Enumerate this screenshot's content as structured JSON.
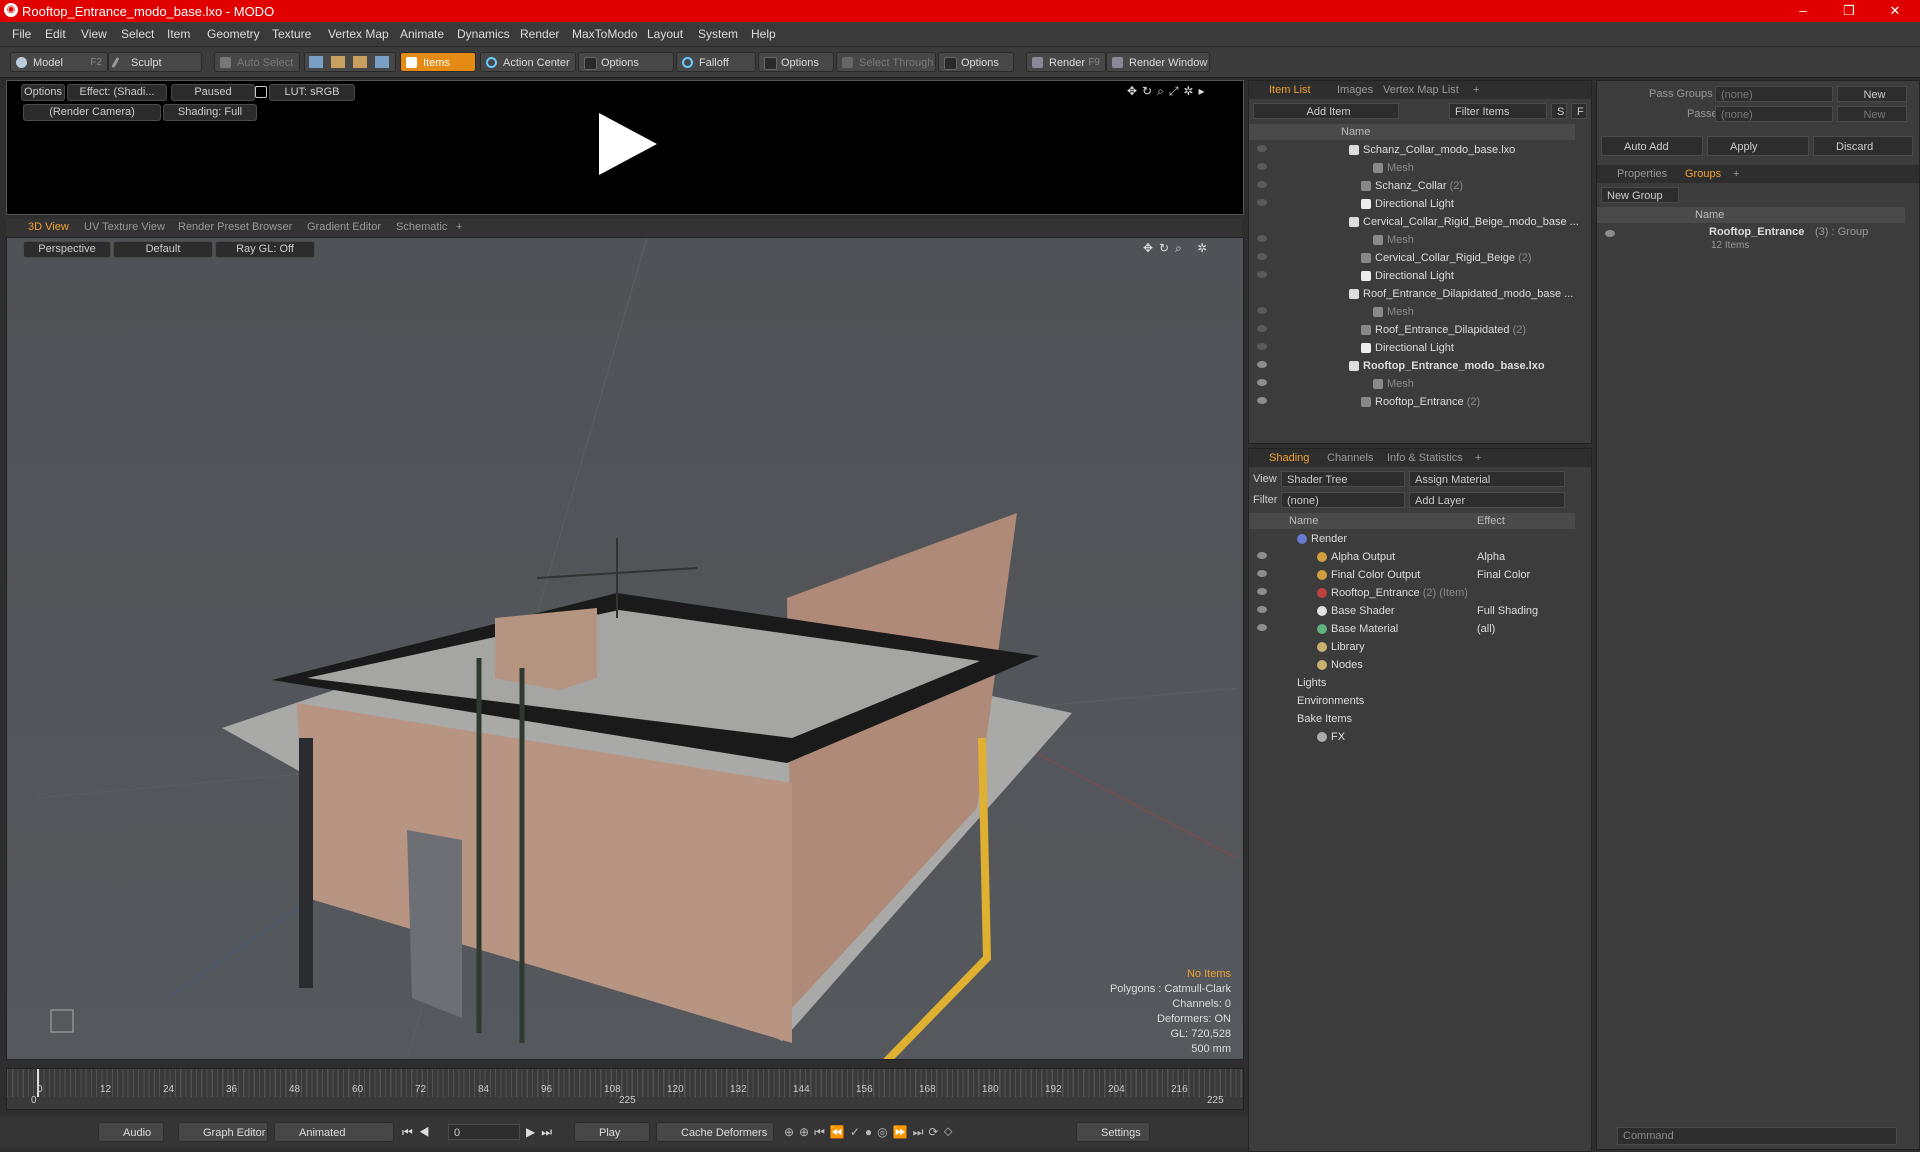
{
  "window": {
    "title": "Rooftop_Entrance_modo_base.lxo - MODO",
    "controls": [
      "–",
      "❐",
      "✕"
    ]
  },
  "menu": [
    "File",
    "Edit",
    "View",
    "Select",
    "Item",
    "Geometry",
    "Texture",
    "Vertex Map",
    "Animate",
    "Dynamics",
    "Render",
    "MaxToModo",
    "Layout",
    "System",
    "Help"
  ],
  "toolbar": {
    "model": "Model",
    "model_key": "F2",
    "sculpt": "Sculpt",
    "auto_select": "Auto Select",
    "items": "Items",
    "action_center": "Action Center",
    "options1": "Options",
    "falloff": "Falloff",
    "options2": "Options",
    "select_through": "Select Through",
    "options3": "Options",
    "render": "Render",
    "render_key": "F9",
    "render_window": "Render Window"
  },
  "render_preview": {
    "options": "Options",
    "effect": "Effect: (Shadi...",
    "paused": "Paused",
    "lut": "LUT: sRGB",
    "camera": "(Render Camera)",
    "shading": "Shading: Full"
  },
  "viewport_tabs": [
    "3D View",
    "UV Texture View",
    "Render Preset Browser",
    "Gradient Editor",
    "Schematic",
    "+"
  ],
  "viewport": {
    "perspective": "Perspective",
    "default": "Default",
    "raygl": "Ray GL: Off",
    "info": {
      "no_items": "No Items",
      "polygons": "Polygons : Catmull-Clark",
      "channels": "Channels: 0",
      "deformers": "Deformers: ON",
      "gl": "GL: 720,528",
      "scale": "500 mm"
    }
  },
  "timeline": {
    "ticks": [
      "0",
      "12",
      "24",
      "36",
      "48",
      "60",
      "72",
      "84",
      "96",
      "108",
      "120",
      "132",
      "144",
      "156",
      "168",
      "180",
      "192",
      "204",
      "216"
    ],
    "start": "0",
    "mid": "225",
    "end": "225"
  },
  "bottombar": {
    "audio": "Audio",
    "graph_editor": "Graph Editor",
    "animated": "Animated",
    "frame": "0",
    "play": "Play",
    "cache_deformers": "Cache Deformers",
    "settings": "Settings"
  },
  "item_list": {
    "tabs": [
      "Item List",
      "Images",
      "Vertex Map List",
      "+"
    ],
    "add_item": "Add Item",
    "filter_items": "Filter Items",
    "s": "S",
    "f": "F",
    "col_name": "Name",
    "rows": [
      {
        "label": "Schanz_Collar_modo_base.lxo",
        "indent": 0,
        "type": "scene",
        "eye": "dim"
      },
      {
        "label": "Mesh",
        "indent": 2,
        "type": "mesh",
        "eye": "dim",
        "grey": true
      },
      {
        "label": "Schanz_Collar",
        "count": "(2)",
        "indent": 1,
        "type": "group",
        "eye": "dim"
      },
      {
        "label": "Directional Light",
        "indent": 1,
        "type": "light",
        "eye": "dim"
      },
      {
        "label": "Cervical_Collar_Rigid_Beige_modo_base ...",
        "indent": 0,
        "type": "scene",
        "eye": "none"
      },
      {
        "label": "Mesh",
        "indent": 2,
        "type": "mesh",
        "eye": "dim",
        "grey": true
      },
      {
        "label": "Cervical_Collar_Rigid_Beige",
        "count": "(2)",
        "indent": 1,
        "type": "group",
        "eye": "dim"
      },
      {
        "label": "Directional Light",
        "indent": 1,
        "type": "light",
        "eye": "dim"
      },
      {
        "label": "Roof_Entrance_Dilapidated_modo_base ...",
        "indent": 0,
        "type": "scene",
        "eye": "none"
      },
      {
        "label": "Mesh",
        "indent": 2,
        "type": "mesh",
        "eye": "dim",
        "grey": true
      },
      {
        "label": "Roof_Entrance_Dilapidated",
        "count": "(2)",
        "indent": 1,
        "type": "group",
        "eye": "dim"
      },
      {
        "label": "Directional Light",
        "indent": 1,
        "type": "light",
        "eye": "dim"
      },
      {
        "label": "Rooftop_Entrance_modo_base.lxo",
        "indent": 0,
        "type": "scene",
        "eye": "on",
        "bold": true
      },
      {
        "label": "Mesh",
        "indent": 2,
        "type": "mesh",
        "eye": "on",
        "grey": true
      },
      {
        "label": "Rooftop_Entrance",
        "count": "(2)",
        "indent": 1,
        "type": "group",
        "eye": "on"
      }
    ]
  },
  "shading": {
    "tabs": [
      "Shading",
      "Channels",
      "Info & Statistics",
      "+"
    ],
    "view_label": "View",
    "view_value": "Shader Tree",
    "assign_material": "Assign Material",
    "filter_label": "Filter",
    "filter_value": "(none)",
    "add_layer": "Add Layer",
    "col_name": "Name",
    "col_effect": "Effect",
    "rows": [
      {
        "label": "Render",
        "effect": "",
        "indent": 0,
        "icon": "render"
      },
      {
        "label": "Alpha Output",
        "effect": "Alpha",
        "indent": 1,
        "icon": "output"
      },
      {
        "label": "Final Color Output",
        "effect": "Final Color",
        "indent": 1,
        "icon": "output"
      },
      {
        "label": "Rooftop_Entrance",
        "count": "(2) (Item)",
        "effect": "",
        "indent": 1,
        "icon": "mask"
      },
      {
        "label": "Base Shader",
        "effect": "Full Shading",
        "indent": 1,
        "icon": "shader"
      },
      {
        "label": "Base Material",
        "effect": "(all)",
        "indent": 1,
        "icon": "material"
      },
      {
        "label": "Library",
        "effect": "",
        "indent": 1,
        "icon": "folder"
      },
      {
        "label": "Nodes",
        "effect": "",
        "indent": 1,
        "icon": "folder"
      },
      {
        "label": "Lights",
        "effect": "",
        "indent": 0,
        "icon": "none"
      },
      {
        "label": "Environments",
        "effect": "",
        "indent": 0,
        "icon": "none"
      },
      {
        "label": "Bake Items",
        "effect": "",
        "indent": 0,
        "icon": "none"
      },
      {
        "label": "FX",
        "effect": "",
        "indent": 1,
        "icon": "fx"
      }
    ]
  },
  "groups": {
    "pass_groups": "Pass Groups",
    "pass_groups_value": "(none)",
    "new": "New",
    "passes": "Passes",
    "passes_value": "(none)",
    "new2": "New",
    "auto_add": "Auto Add",
    "apply": "Apply",
    "discard": "Discard",
    "tabs": [
      "Properties",
      "Groups",
      "+"
    ],
    "new_group": "New Group",
    "col_name": "Name",
    "group_name": "Rooftop_Entrance",
    "group_count": "(3) : Group",
    "group_items": "12 Items"
  },
  "command": {
    "placeholder": "Command"
  }
}
